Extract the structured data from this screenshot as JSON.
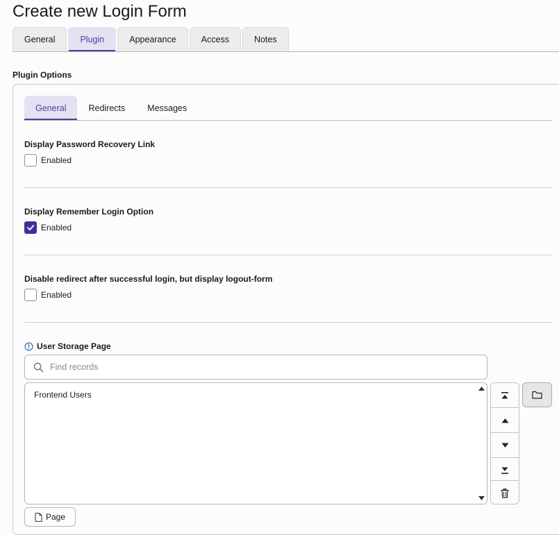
{
  "page": {
    "title": "Create new Login Form"
  },
  "top_tabs": [
    {
      "label": "General",
      "active": false
    },
    {
      "label": "Plugin",
      "active": true
    },
    {
      "label": "Appearance",
      "active": false
    },
    {
      "label": "Access",
      "active": false
    },
    {
      "label": "Notes",
      "active": false
    }
  ],
  "section": {
    "title": "Plugin Options"
  },
  "inner_tabs": [
    {
      "label": "General",
      "active": true
    },
    {
      "label": "Redirects",
      "active": false
    },
    {
      "label": "Messages",
      "active": false
    }
  ],
  "fields": [
    {
      "label": "Display Password Recovery Link",
      "check_label": "Enabled",
      "checked": false
    },
    {
      "label": "Display Remember Login Option",
      "check_label": "Enabled",
      "checked": true
    },
    {
      "label": "Disable redirect after successful login, but display logout-form",
      "check_label": "Enabled",
      "checked": false
    }
  ],
  "storage": {
    "label": "User Storage Page",
    "search_placeholder": "Find records",
    "records": [
      "Frontend Users"
    ],
    "add_page_label": "Page"
  },
  "colors": {
    "accent": "#4a3fa3",
    "tab_active_bg": "#e4e1f3",
    "checkbox_checked": "#3e2f9c",
    "info_icon": "#2a6fb0"
  },
  "icons": {
    "search": "search-icon",
    "info": "info-icon",
    "move_top": "move-to-top-icon",
    "move_up": "move-up-icon",
    "move_down": "move-down-icon",
    "move_bottom": "move-to-bottom-icon",
    "delete": "trash-icon",
    "browse": "folder-icon",
    "page": "page-icon",
    "check": "check-icon"
  }
}
